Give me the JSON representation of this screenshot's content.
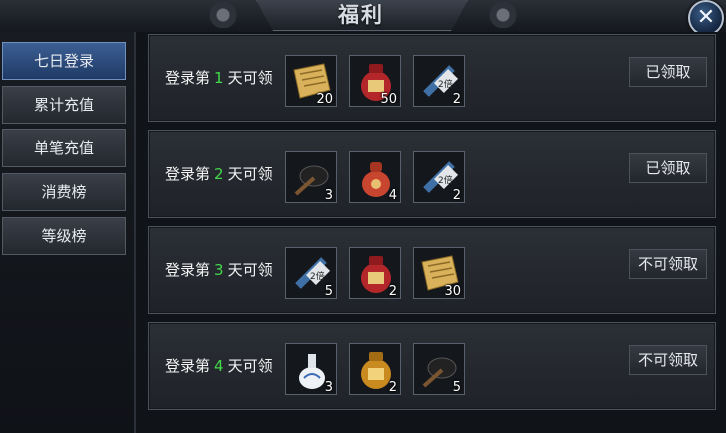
{
  "window": {
    "title": "福利",
    "close_glyph": "✕"
  },
  "sidebar": {
    "items": [
      {
        "label": "七日登录",
        "active": true
      },
      {
        "label": "累计充值",
        "active": false
      },
      {
        "label": "单笔充值",
        "active": false
      },
      {
        "label": "消费榜",
        "active": false
      },
      {
        "label": "等级榜",
        "active": false
      }
    ]
  },
  "rewards": [
    {
      "prefix": "登录第",
      "day": "1",
      "suffix": "天可领",
      "status": "已领取",
      "items": [
        {
          "icon": "scroll-paper-icon",
          "count": "20"
        },
        {
          "icon": "red-wine-jar-icon",
          "count": "50"
        },
        {
          "icon": "double-exp-scroll-icon",
          "count": "2"
        }
      ]
    },
    {
      "prefix": "登录第",
      "day": "2",
      "suffix": "天可领",
      "status": "已领取",
      "items": [
        {
          "icon": "black-whip-icon",
          "count": "3"
        },
        {
          "icon": "red-pouch-gourd-icon",
          "count": "4"
        },
        {
          "icon": "double-exp-scroll-icon",
          "count": "2"
        }
      ]
    },
    {
      "prefix": "登录第",
      "day": "3",
      "suffix": "天可领",
      "status": "不可领取",
      "items": [
        {
          "icon": "double-exp-scroll-icon",
          "count": "5"
        },
        {
          "icon": "red-wine-jar-icon",
          "count": "2"
        },
        {
          "icon": "scroll-paper-icon",
          "count": "30"
        }
      ]
    },
    {
      "prefix": "登录第",
      "day": "4",
      "suffix": "天可领",
      "status": "不可领取",
      "items": [
        {
          "icon": "white-porcelain-flask-icon",
          "count": "3"
        },
        {
          "icon": "golden-wine-jar-icon",
          "count": "2"
        },
        {
          "icon": "black-whip-icon",
          "count": "5"
        }
      ]
    }
  ],
  "colors": {
    "accent_day": "#43d94a",
    "active_tab": "#2c4c80"
  }
}
